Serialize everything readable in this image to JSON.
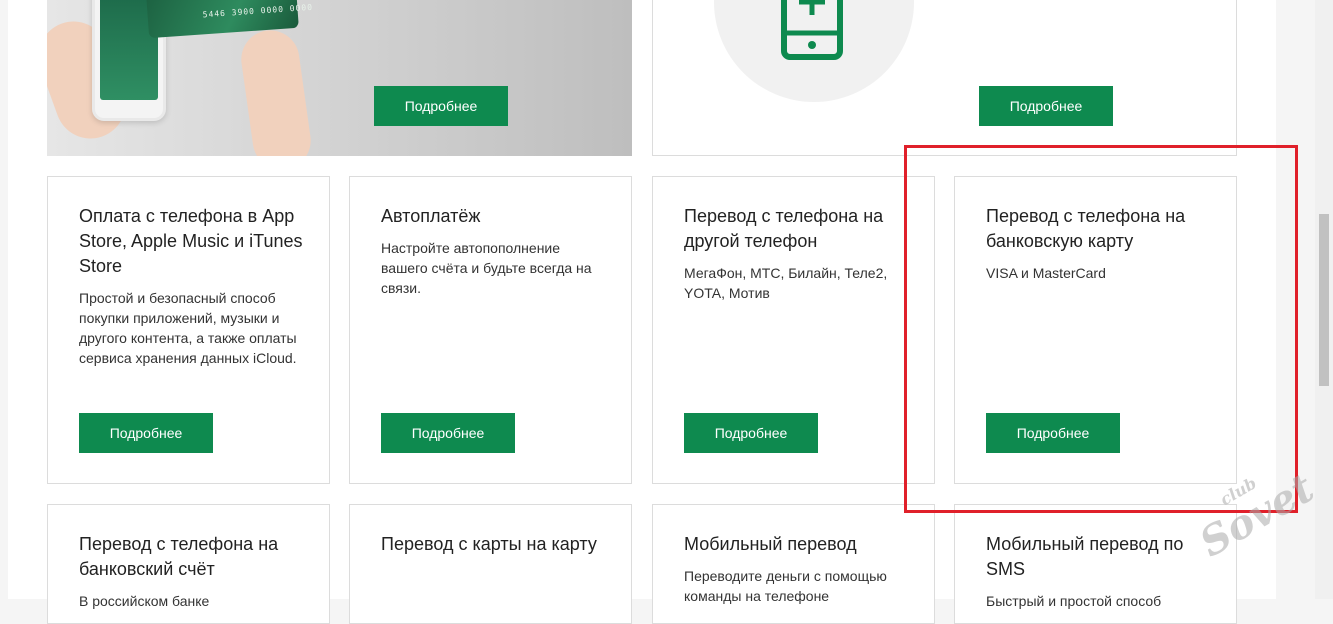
{
  "top_cards": [
    {
      "button_label": "Подробнее"
    },
    {
      "button_label": "Подробнее"
    }
  ],
  "bank_card_number": "5446 3900 0000 0000",
  "cards_row1": [
    {
      "title": "Оплата с телефона в App Store, Apple Music и iTunes Store",
      "description": "Простой и безопасный способ покупки приложений, музыки и другого контента, а также оплаты сервиса хранения данных iCloud.",
      "button_label": "Подробнее"
    },
    {
      "title": "Автоплатёж",
      "description": "Настройте автопополнение вашего счёта и будьте всегда на связи.",
      "button_label": "Подробнее"
    },
    {
      "title": "Перевод с телефона на другой телефон",
      "description": "МегаФон, МТС, Билайн, Теле2, YOTA, Мотив",
      "button_label": "Подробнее"
    },
    {
      "title": "Перевод с телефона на банковскую карту",
      "description": "VISA и MasterCard",
      "button_label": "Подробнее"
    }
  ],
  "cards_row2": [
    {
      "title": "Перевод с телефона на банковский счёт",
      "description": "В российском банке"
    },
    {
      "title": "Перевод с карты на карту",
      "description": ""
    },
    {
      "title": "Мобильный перевод",
      "description": "Переводите деньги с помощью команды на телефоне"
    },
    {
      "title": "Мобильный перевод по SMS",
      "description": "Быстрый и простой способ"
    }
  ],
  "watermark": {
    "small": "club",
    "big": "Sovet"
  },
  "colors": {
    "button_green": "#0e8a4f",
    "phone_icon_green": "#0e8a4f",
    "highlight_red": "#e0202a",
    "card_border": "#dcdcdc"
  },
  "icons": [
    "mobile-phone-plus-icon"
  ]
}
